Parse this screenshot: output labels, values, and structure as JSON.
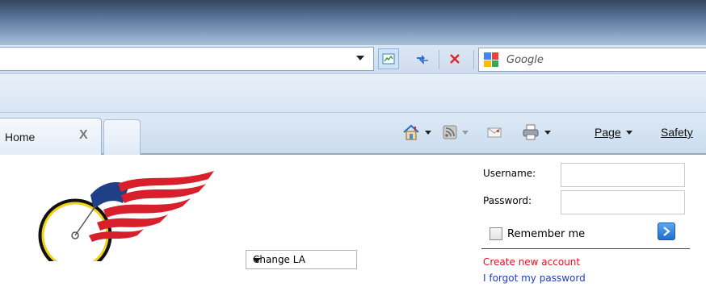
{
  "browser": {
    "search": {
      "placeholder": "Google"
    },
    "tabs": [
      {
        "label": "Home",
        "close": "X"
      }
    ],
    "commands": {
      "page": "Page",
      "safety": "Safety"
    }
  },
  "site": {
    "language_select": {
      "value": "Change LA"
    },
    "login": {
      "username_label": "Username:",
      "password_label": "Password:",
      "remember_label": "Remember me",
      "create_account": "Create new account",
      "forgot_password": "I forgot my password"
    }
  },
  "colors": {
    "create_link": "#e8101a",
    "forgot_link": "#1a3fc2",
    "go_button": "#1f6fd0"
  }
}
